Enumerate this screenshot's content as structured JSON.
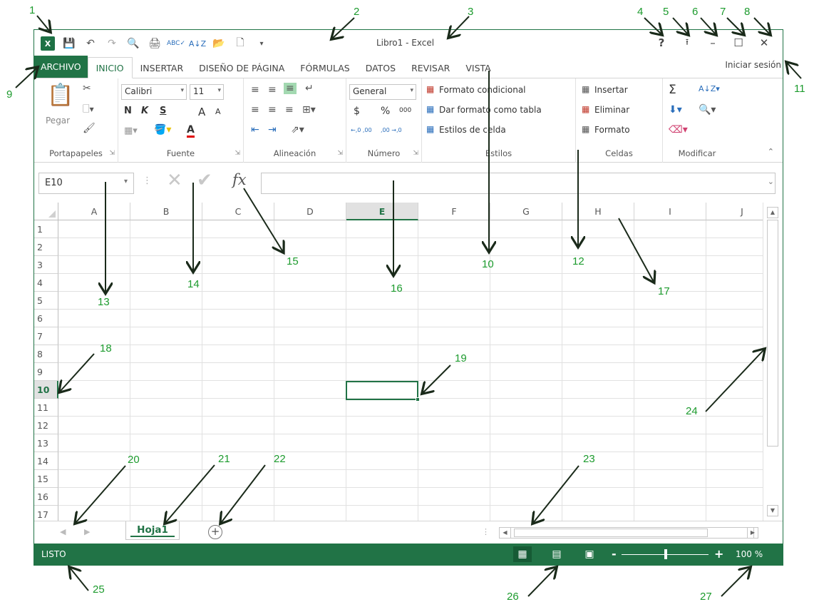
{
  "window": {
    "title": "Libro1 - Excel"
  },
  "quick_access": [
    "excel-logo",
    "save",
    "undo",
    "redo",
    "print-preview",
    "quick-print",
    "spelling",
    "sort-ascending",
    "open",
    "new",
    "customize"
  ],
  "window_controls": {
    "help": "?",
    "ribbon_display": "⭱",
    "minimize": "–",
    "restore": "☐",
    "close": "✕"
  },
  "tabs": [
    {
      "label": "ARCHIVO"
    },
    {
      "label": "INICIO"
    },
    {
      "label": "INSERTAR"
    },
    {
      "label": "DISEÑO DE PÁGINA"
    },
    {
      "label": "FÓRMULAS"
    },
    {
      "label": "DATOS"
    },
    {
      "label": "REVISAR"
    },
    {
      "label": "VISTA"
    }
  ],
  "signin": "Iniciar sesión",
  "ribbon": {
    "clipboard": {
      "label": "Portapapeles",
      "paste": "Pegar"
    },
    "font": {
      "label": "Fuente",
      "name": "Calibri",
      "size": "11",
      "bold": "N",
      "italic": "K",
      "underline": "S",
      "grow": "A",
      "shrink": "A",
      "font_color": "A"
    },
    "alignment": {
      "label": "Alineación"
    },
    "number": {
      "label": "Número",
      "format": "General",
      "currency": "$",
      "percent": "%",
      "thousands": "000",
      "inc_decimal": "←,0 ,00",
      "dec_decimal": ",00 →,0"
    },
    "styles": {
      "label": "Estilos",
      "conditional": "Formato condicional",
      "as_table": "Dar formato como tabla",
      "cell_styles": "Estilos de celda"
    },
    "cells": {
      "label": "Celdas",
      "insert": "Insertar",
      "delete": "Eliminar",
      "format": "Formato"
    },
    "editing": {
      "label": "Modificar",
      "sum": "Σ"
    }
  },
  "formula_bar": {
    "name_box": "E10",
    "cancel": "✕",
    "enter": "✔",
    "fx": "fx",
    "value": ""
  },
  "columns": [
    "A",
    "B",
    "C",
    "D",
    "E",
    "F",
    "G",
    "H",
    "I",
    "J"
  ],
  "selected_column": "E",
  "rows": [
    "1",
    "2",
    "3",
    "4",
    "5",
    "6",
    "7",
    "8",
    "9",
    "10",
    "11",
    "12",
    "13",
    "14",
    "15",
    "16",
    "17"
  ],
  "selected_row": "10",
  "sheets": [
    {
      "label": "Hoja1"
    }
  ],
  "status": {
    "ready": "LISTO",
    "zoom": "100 %",
    "zoom_minus": "-",
    "zoom_plus": "+"
  },
  "annotations": [
    "1",
    "2",
    "3",
    "4",
    "5",
    "6",
    "7",
    "8",
    "9",
    "10",
    "11",
    "12",
    "13",
    "14",
    "15",
    "16",
    "17",
    "18",
    "19",
    "20",
    "21",
    "22",
    "23",
    "24",
    "25",
    "26",
    "27"
  ],
  "colors": {
    "accent": "#217346",
    "annotation": "#1d9b2e"
  }
}
